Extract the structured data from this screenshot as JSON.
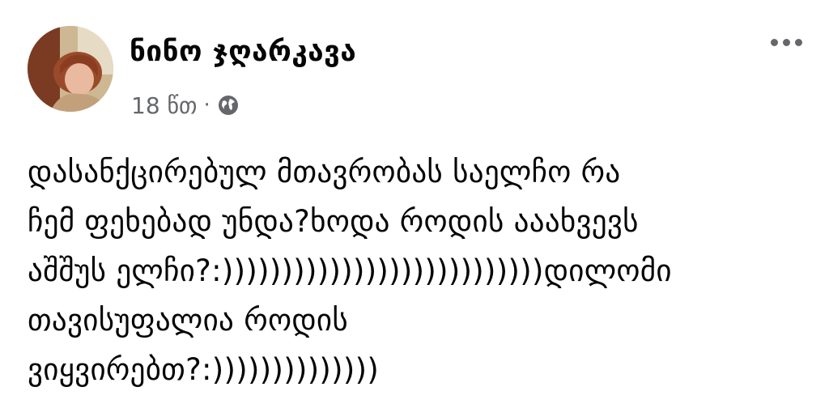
{
  "post": {
    "author": "ნინო ჯღარკავა",
    "time": "18 წთ",
    "separator": "·",
    "privacy_icon": "globe-icon",
    "menu_icon": "more-options-icon",
    "message_lines": [
      "დასანქცირებულ მთავრობას საელჩო რა",
      "ჩემ ფეხებად უნდა?ხოდა როდის ააახვევს",
      "აშშუს ელჩი?:)))))))))))))))))))))))))))დილომი",
      "თავისუფალია როდის",
      "ვიყვირებთ?:))))))))))))))"
    ]
  },
  "colors": {
    "text": "#050505",
    "secondary": "#65676b",
    "background": "#ffffff"
  }
}
